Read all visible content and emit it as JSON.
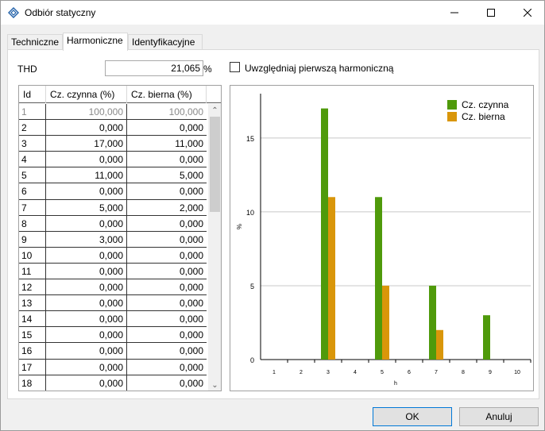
{
  "window": {
    "title": "Odbiór statyczny"
  },
  "tabs": [
    {
      "label": "Techniczne",
      "active": false
    },
    {
      "label": "Harmoniczne",
      "active": true
    },
    {
      "label": "Identyfikacyjne",
      "active": false
    }
  ],
  "thd": {
    "label": "THD",
    "value": "21,065",
    "unit": "%"
  },
  "first_harmonic": {
    "label": "Uwzględniaj pierwszą harmoniczną",
    "checked": false
  },
  "table": {
    "columns": [
      "Id",
      "Cz. czynna (%)",
      "Cz. bierna (%)"
    ],
    "rows": [
      [
        "1",
        "100,000",
        "100,000"
      ],
      [
        "2",
        "0,000",
        "0,000"
      ],
      [
        "3",
        "17,000",
        "11,000"
      ],
      [
        "4",
        "0,000",
        "0,000"
      ],
      [
        "5",
        "11,000",
        "5,000"
      ],
      [
        "6",
        "0,000",
        "0,000"
      ],
      [
        "7",
        "5,000",
        "2,000"
      ],
      [
        "8",
        "0,000",
        "0,000"
      ],
      [
        "9",
        "3,000",
        "0,000"
      ],
      [
        "10",
        "0,000",
        "0,000"
      ],
      [
        "11",
        "0,000",
        "0,000"
      ],
      [
        "12",
        "0,000",
        "0,000"
      ],
      [
        "13",
        "0,000",
        "0,000"
      ],
      [
        "14",
        "0,000",
        "0,000"
      ],
      [
        "15",
        "0,000",
        "0,000"
      ],
      [
        "16",
        "0,000",
        "0,000"
      ],
      [
        "17",
        "0,000",
        "0,000"
      ],
      [
        "18",
        "0,000",
        "0,000"
      ]
    ]
  },
  "chart_data": {
    "type": "bar",
    "categories": [
      "1",
      "2",
      "3",
      "4",
      "5",
      "6",
      "7",
      "8",
      "9",
      "10"
    ],
    "series": [
      {
        "name": "Cz. czynna",
        "color": "#4f9a0b",
        "values": [
          0,
          0,
          17,
          0,
          11,
          0,
          5,
          0,
          3,
          0
        ]
      },
      {
        "name": "Cz. bierna",
        "color": "#d9960a",
        "values": [
          0,
          0,
          11,
          0,
          5,
          0,
          2,
          0,
          0,
          0
        ]
      }
    ],
    "xlabel": "h",
    "ylabel": "%",
    "ylim": [
      0,
      18
    ],
    "yticks": [
      "0",
      "5",
      "10",
      "15"
    ],
    "grid": "horizontal",
    "legend": "top-right"
  },
  "buttons": {
    "ok": "OK",
    "cancel": "Anuluj"
  }
}
